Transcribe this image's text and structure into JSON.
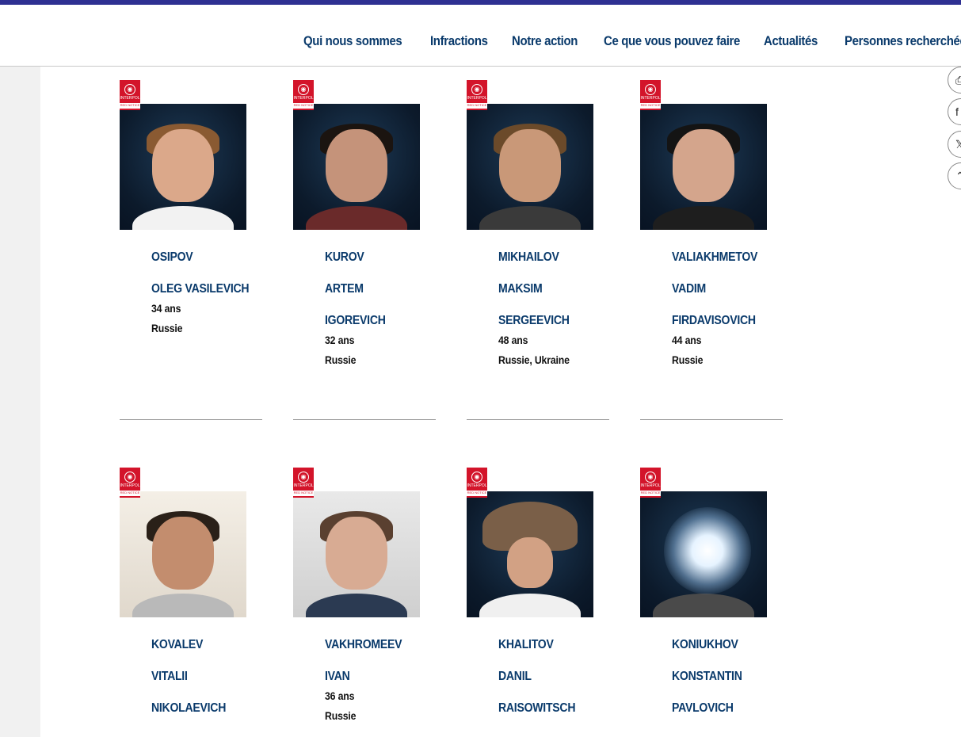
{
  "nav": {
    "items": [
      "Qui nous sommes",
      "Infractions",
      "Notre action",
      "Ce que vous pouvez faire",
      "Actualités",
      "Personnes recherchées"
    ]
  },
  "badge": {
    "line1": "INTERPOL",
    "line2": "RED NOTICE"
  },
  "share": {
    "icons": [
      "print-icon",
      "facebook-icon",
      "x-icon",
      "scroll-top-icon"
    ]
  },
  "notices": [
    {
      "last": "OSIPOV",
      "first": "OLEG VASILEVICH",
      "middle": "",
      "age": "34 ans",
      "nationality": "Russie"
    },
    {
      "last": "KUROV",
      "first": "ARTEM",
      "middle": "IGOREVICH",
      "age": "32 ans",
      "nationality": "Russie"
    },
    {
      "last": "MIKHAILOV",
      "first": "MAKSIM",
      "middle": "SERGEEVICH",
      "age": "48 ans",
      "nationality": "Russie, Ukraine"
    },
    {
      "last": "VALIAKHMETOV",
      "first": "VADIM",
      "middle": "FIRDAVISOVICH",
      "age": "44 ans",
      "nationality": "Russie"
    },
    {
      "last": "KOVALEV",
      "first": "VITALII",
      "middle": "NIKOLAEVICH",
      "age": "",
      "nationality": ""
    },
    {
      "last": "VAKHROMEEV",
      "first": "IVAN",
      "middle": "",
      "age": "36 ans",
      "nationality": "Russie"
    },
    {
      "last": "KHALITOV",
      "first": "DANIL",
      "middle": "RAISOWITSCH",
      "age": "",
      "nationality": ""
    },
    {
      "last": "KONIUKHOV",
      "first": "KONSTANTIN",
      "middle": "PAVLOVICH",
      "age": "",
      "nationality": ""
    }
  ]
}
